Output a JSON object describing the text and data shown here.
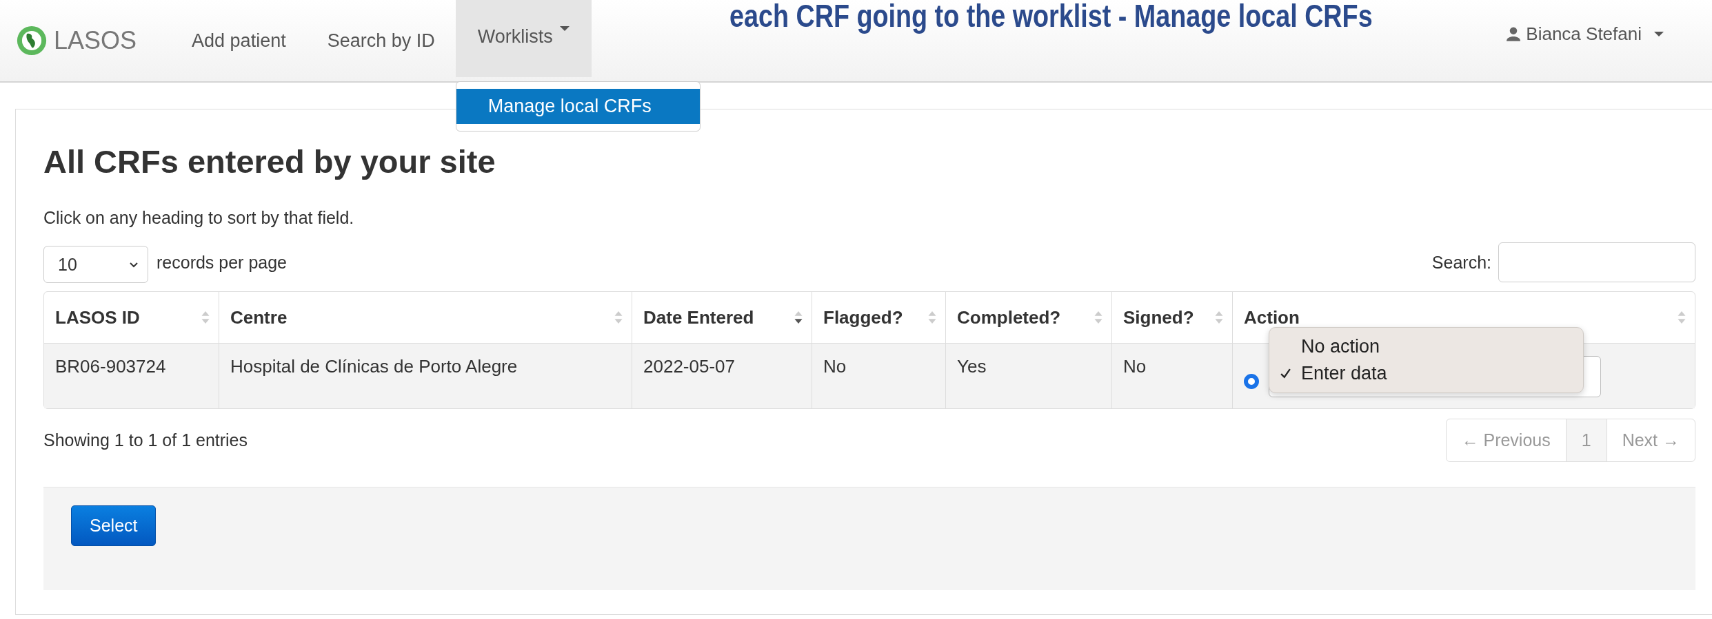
{
  "annotation": "each CRF going to the worklist - Manage local CRFs",
  "navbar": {
    "brand": "LASOS",
    "items": [
      {
        "label": "Add patient",
        "selected": false,
        "dropdown": false
      },
      {
        "label": "Search by ID",
        "selected": false,
        "dropdown": false
      },
      {
        "label": "Worklists",
        "selected": true,
        "dropdown": true
      }
    ],
    "menu": [
      {
        "label": "Manage local CRFs",
        "selected": true
      }
    ],
    "user": "Bianca Stefani"
  },
  "page": {
    "title": "All CRFs entered by your site",
    "hint": "Click on any heading to sort by that field.",
    "page_size": "10",
    "page_size_label": "records per page",
    "search_label": "Search:",
    "table": {
      "columns": [
        {
          "label": "LASOS ID",
          "sorted": false
        },
        {
          "label": "Centre",
          "sorted": false
        },
        {
          "label": "Date Entered",
          "sorted": true
        },
        {
          "label": "Flagged?",
          "sorted": false
        },
        {
          "label": "Completed?",
          "sorted": false
        },
        {
          "label": "Signed?",
          "sorted": false
        },
        {
          "label": "Action",
          "sorted": false
        }
      ],
      "rows": [
        {
          "cells": [
            "BR06-903724",
            "Hospital de Clínicas de Porto Alegre",
            "2022-05-07",
            "No",
            "Yes",
            "No"
          ],
          "radio_checked": true
        }
      ]
    },
    "action_menu": [
      {
        "label": "No action",
        "selected": false
      },
      {
        "label": "Enter data",
        "selected": true
      }
    ],
    "info": "Showing 1 to 1 of 1 entries",
    "pagination": [
      {
        "label": "← Previous",
        "kind": "prev",
        "disabled": true
      },
      {
        "label": "1",
        "kind": "page",
        "selected": true
      },
      {
        "label": "Next →",
        "kind": "next",
        "disabled": true
      }
    ],
    "submit": "Select"
  }
}
